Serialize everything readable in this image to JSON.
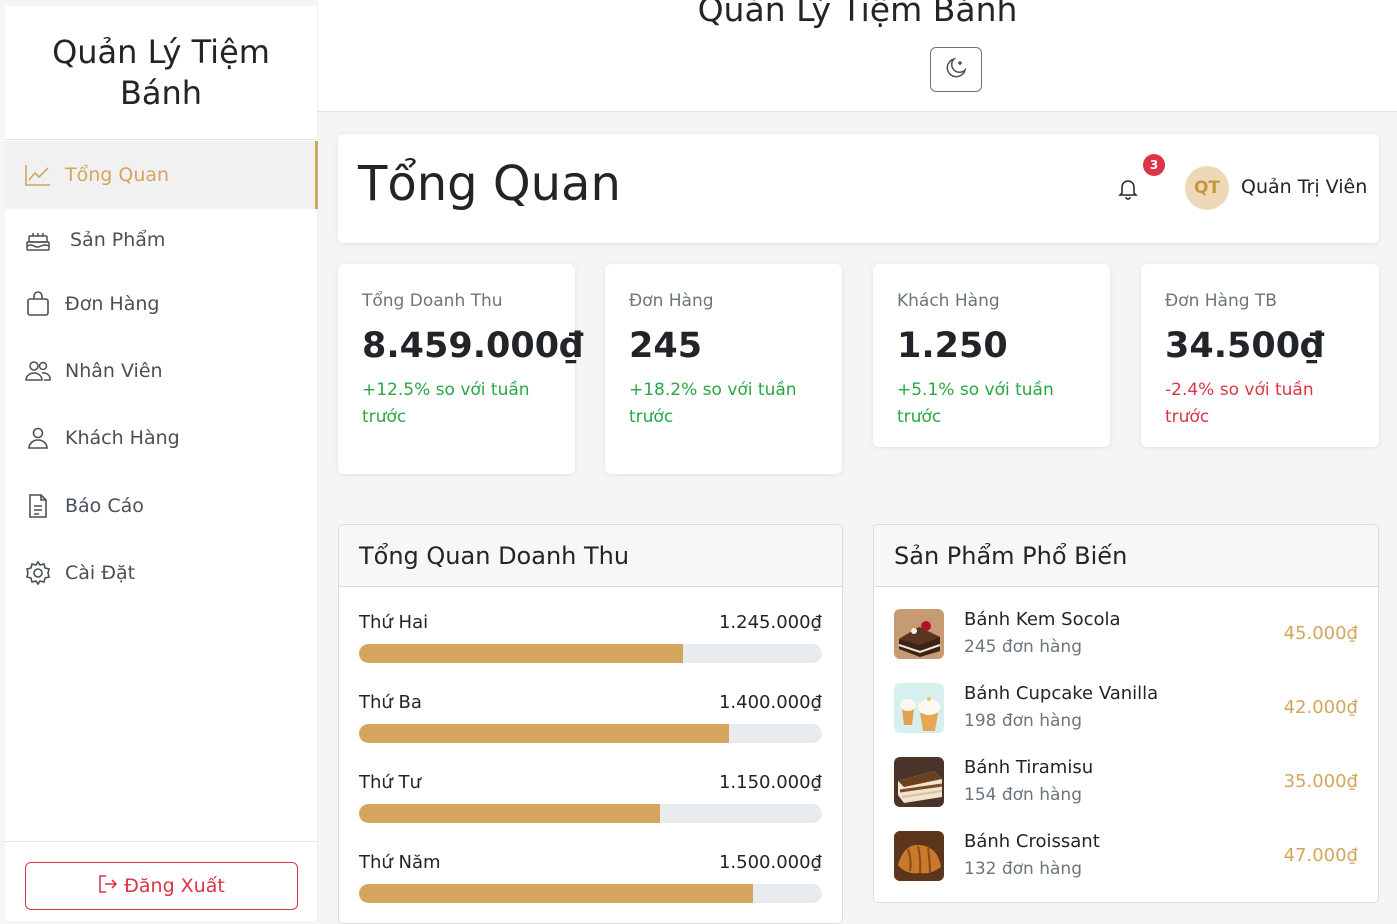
{
  "app": {
    "title": "Quản Lý Tiệm Bánh",
    "brand": "Quản Lý Tiệm Bánh"
  },
  "sidebar": {
    "items": [
      {
        "label": "Tổng Quan",
        "icon": "chart-line-icon",
        "active": true
      },
      {
        "label": "Sản Phẩm",
        "icon": "cake-icon"
      },
      {
        "label": "Đơn Hàng",
        "icon": "bag-icon"
      },
      {
        "label": "Nhân Viên",
        "icon": "people-icon"
      },
      {
        "label": "Khách Hàng",
        "icon": "person-icon"
      },
      {
        "label": "Báo Cáo",
        "icon": "document-icon"
      },
      {
        "label": "Cài Đặt",
        "icon": "gear-icon"
      }
    ],
    "logout_label": "Đăng Xuất"
  },
  "header": {
    "page_title": "Tổng Quan",
    "notification_count": "3",
    "avatar_initials": "QT",
    "user_name": "Quản Trị Viên"
  },
  "stats": [
    {
      "label": "Tổng Doanh Thu",
      "value": "8.459.000₫",
      "change": "+12.5% so với tuần trước",
      "trend": "up"
    },
    {
      "label": "Đơn Hàng",
      "value": "245",
      "change": "+18.2% so với tuần trước",
      "trend": "up"
    },
    {
      "label": "Khách Hàng",
      "value": "1.250",
      "change": "+5.1% so với tuần trước",
      "trend": "up"
    },
    {
      "label": "Đơn Hàng TB",
      "value": "34.500₫",
      "change": "-2.4% so với tuần trước",
      "trend": "down"
    }
  ],
  "revenue": {
    "title": "Tổng Quan Doanh Thu",
    "rows": [
      {
        "day": "Thứ Hai",
        "amount": "1.245.000₫",
        "fraction": 0.7
      },
      {
        "day": "Thứ Ba",
        "amount": "1.400.000₫",
        "fraction": 0.8
      },
      {
        "day": "Thứ Tư",
        "amount": "1.150.000₫",
        "fraction": 0.65
      },
      {
        "day": "Thứ Năm",
        "amount": "1.500.000₫",
        "fraction": 0.85
      }
    ]
  },
  "popular": {
    "title": "Sản Phẩm Phổ Biến",
    "items": [
      {
        "name": "Bánh Kem Socola",
        "orders": "245 đơn hàng",
        "price": "45.000₫"
      },
      {
        "name": "Bánh Cupcake Vanilla",
        "orders": "198 đơn hàng",
        "price": "42.000₫"
      },
      {
        "name": "Bánh Tiramisu",
        "orders": "154 đơn hàng",
        "price": "35.000₫"
      },
      {
        "name": "Bánh Croissant",
        "orders": "132 đơn hàng",
        "price": "47.000₫"
      }
    ]
  },
  "colors": {
    "accent": "#d4a55c",
    "positive": "#28a745",
    "negative": "#dc3545"
  }
}
